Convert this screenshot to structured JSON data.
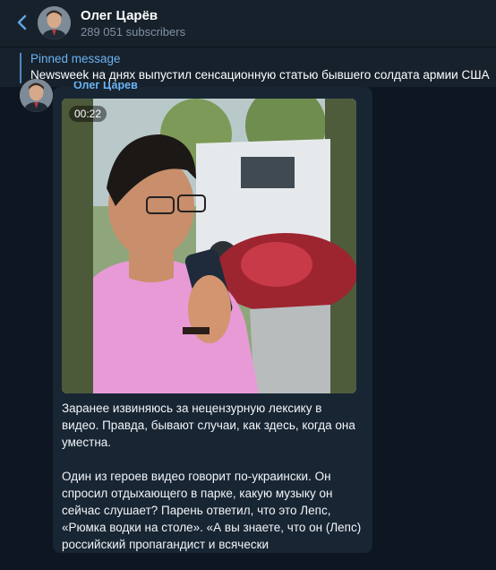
{
  "header": {
    "channel_name": "Олег Царёв",
    "subscribers": "289 051 subscribers"
  },
  "pinned": {
    "title": "Pinned message",
    "text": "Newsweek на днях выпустил сенсационную статью бывшего солдата армии США"
  },
  "message": {
    "sender": "Олег Царев",
    "video_duration": "00:22",
    "paragraph1": "Заранее извиняюсь за нецензурную лексику в видео. Правда, бывают случаи, как здесь, когда она уместна.",
    "paragraph2": "Один из героев видео говорит по-украински. Он спросил отдыхающего в парке, какую музыку он сейчас слушает? Парень ответил, что это Лепс, «Рюмка водки на столе». «А вы знаете, что он (Лепс) российский пропагандист и всячески"
  },
  "colors": {
    "background": "#0e1621",
    "header": "#17212b",
    "accent": "#6ab3f3",
    "bubble": "#182533"
  },
  "icons": {
    "back": "chevron-left-icon",
    "pinned_bar": "pinned-bar"
  }
}
